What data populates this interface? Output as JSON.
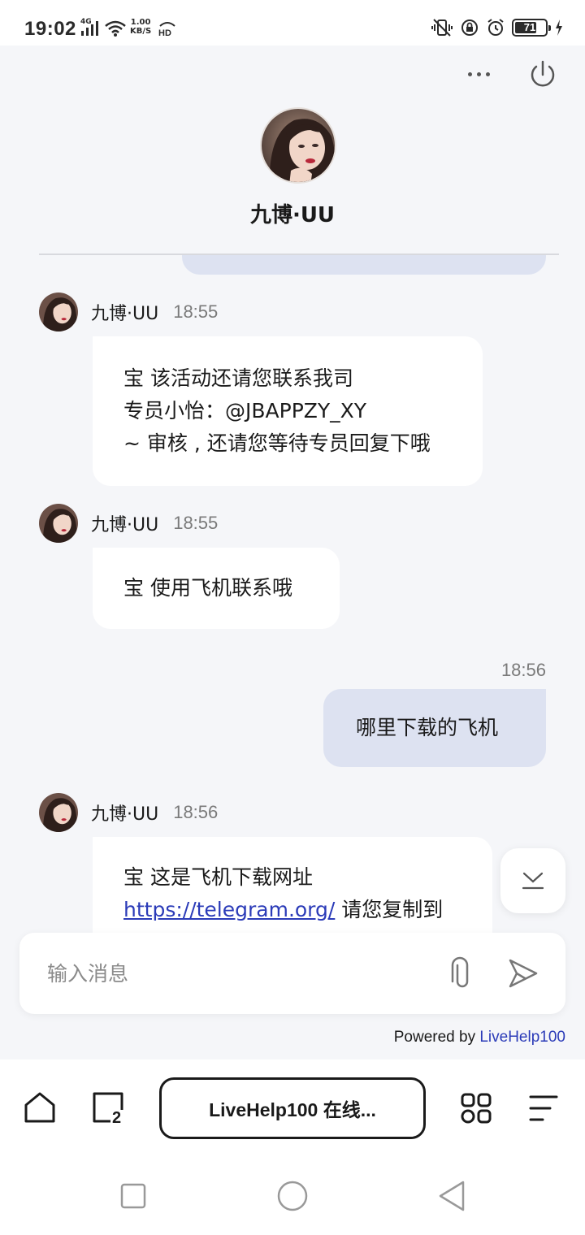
{
  "status_bar": {
    "time": "19:02",
    "network": "4G",
    "speed_value": "1.00",
    "speed_unit": "KB/S",
    "hd": "HD",
    "battery": "71",
    "battery_level": 0.71
  },
  "header": {
    "agent_name": "九博·UU",
    "icons": [
      "more-icon",
      "power-icon"
    ]
  },
  "messages": [
    {
      "sender": "九博·UU",
      "time": "18:55",
      "lines": [
        "宝 该活动还请您联系我司",
        "专员小怡：@JBAPPZY_XY",
        "~ 审核 , 还请您等待专员回复下哦"
      ]
    },
    {
      "sender": "九博·UU",
      "time": "18:55",
      "lines": [
        "宝 使用飞机联系哦"
      ]
    },
    {
      "sender": "me",
      "time": "18:56",
      "lines": [
        "哪里下载的飞机"
      ]
    },
    {
      "sender": "九博·UU",
      "time": "18:56",
      "line1": "宝 这是飞机下载网址",
      "link": "https://telegram.org/",
      "after_link": " 请您复制到"
    }
  ],
  "composer": {
    "placeholder": "输入消息",
    "icons": [
      "paperclip-icon",
      "send-icon"
    ]
  },
  "footer": {
    "powered_prefix": "Powered by ",
    "powered_brand": "LiveHelp100"
  },
  "browser": {
    "tab_title": "LiveHelp100 在线...",
    "tab_count": "2"
  },
  "colors": {
    "page_bg": "#f5f6f9",
    "outgoing_bubble": "#dde2f1",
    "incoming_bubble": "#ffffff",
    "link": "#2b3bb8"
  }
}
